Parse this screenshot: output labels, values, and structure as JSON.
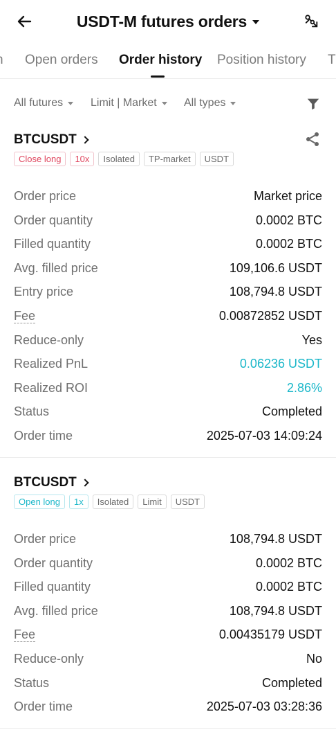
{
  "header": {
    "title": "USDT-M futures orders",
    "back_icon": "arrow-left-icon",
    "share_icon": "share-screenshot-icon"
  },
  "tabs": [
    {
      "label": "n",
      "active": false
    },
    {
      "label": "Open orders",
      "active": false
    },
    {
      "label": "Order history",
      "active": true
    },
    {
      "label": "Position history",
      "active": false
    },
    {
      "label": "T",
      "active": false
    }
  ],
  "filters": {
    "futures": "All futures",
    "order_kind": "Limit | Market",
    "types": "All types",
    "filter_icon": "funnel-icon"
  },
  "orders": [
    {
      "symbol": "BTCUSDT",
      "tags": [
        {
          "label": "Close long",
          "color": "#e0455e"
        },
        {
          "label": "10x",
          "color": "#e0455e"
        },
        {
          "label": "Isolated",
          "color": "#6a6a6a"
        },
        {
          "label": "TP-market",
          "color": "#6a6a6a"
        },
        {
          "label": "USDT",
          "color": "#6a6a6a"
        }
      ],
      "rows": [
        {
          "label": "Order price",
          "value": "Market price"
        },
        {
          "label": "Order quantity",
          "value": "0.0002 BTC"
        },
        {
          "label": "Filled quantity",
          "value": "0.0002 BTC"
        },
        {
          "label": "Avg. filled price",
          "value": "109,106.6 USDT"
        },
        {
          "label": "Entry price",
          "value": "108,794.8 USDT"
        },
        {
          "label": "Fee",
          "value": "0.00872852 USDT"
        },
        {
          "label": "Reduce-only",
          "value": "Yes"
        },
        {
          "label": "Realized PnL",
          "value": "0.06236 USDT"
        },
        {
          "label": "Realized ROI",
          "value": "2.86%"
        },
        {
          "label": "Status",
          "value": "Completed"
        },
        {
          "label": "Order time",
          "value": "2025-07-03 14:09:24"
        }
      ]
    },
    {
      "symbol": "BTCUSDT",
      "tags": [
        {
          "label": "Open long",
          "color": "#1ab7c9"
        },
        {
          "label": "1x",
          "color": "#1ab7c9"
        },
        {
          "label": "Isolated",
          "color": "#6a6a6a"
        },
        {
          "label": "Limit",
          "color": "#6a6a6a"
        },
        {
          "label": "USDT",
          "color": "#6a6a6a"
        }
      ],
      "rows": [
        {
          "label": "Order price",
          "value": "108,794.8 USDT"
        },
        {
          "label": "Order quantity",
          "value": "0.0002 BTC"
        },
        {
          "label": "Filled quantity",
          "value": "0.0002 BTC"
        },
        {
          "label": "Avg. filled price",
          "value": "108,794.8 USDT"
        },
        {
          "label": "Fee",
          "value": "0.00435179 USDT"
        },
        {
          "label": "Reduce-only",
          "value": "No"
        },
        {
          "label": "Status",
          "value": "Completed"
        },
        {
          "label": "Order time",
          "value": "2025-07-03 03:28:36"
        }
      ]
    }
  ],
  "colors": {
    "accent_teal": "#1ab7c9",
    "close_red": "#e0455e",
    "label_gray": "#6f6f6f"
  }
}
